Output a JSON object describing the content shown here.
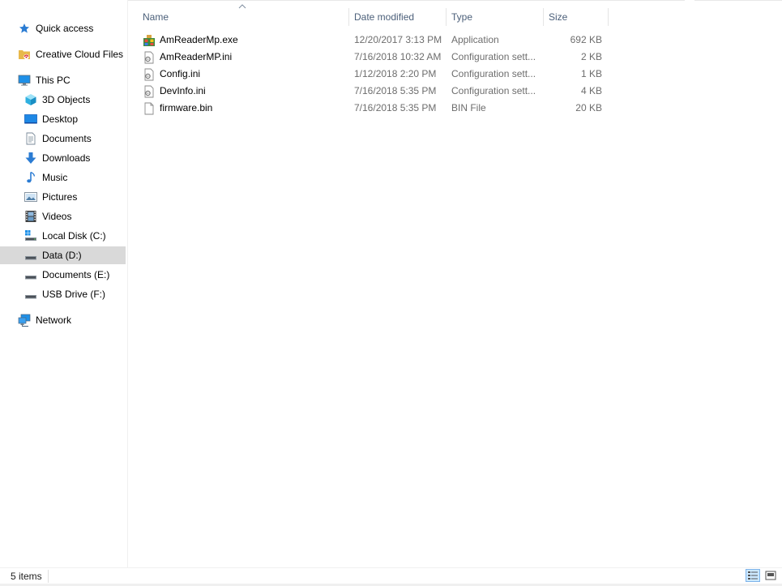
{
  "nav": {
    "items": [
      {
        "label": "Quick access",
        "icon": "star-icon"
      },
      {
        "label": "Creative Cloud Files",
        "icon": "creative-cloud-folder-icon"
      },
      {
        "label": "This PC",
        "icon": "computer-icon"
      },
      {
        "label": "3D Objects",
        "icon": "cube-icon"
      },
      {
        "label": "Desktop",
        "icon": "desktop-icon"
      },
      {
        "label": "Documents",
        "icon": "documents-icon"
      },
      {
        "label": "Downloads",
        "icon": "download-arrow-icon"
      },
      {
        "label": "Music",
        "icon": "music-note-icon"
      },
      {
        "label": "Pictures",
        "icon": "pictures-icon"
      },
      {
        "label": "Videos",
        "icon": "film-icon"
      },
      {
        "label": "Local Disk (C:)",
        "icon": "windows-drive-icon"
      },
      {
        "label": "Data (D:)",
        "icon": "drive-icon",
        "selected": true
      },
      {
        "label": "Documents (E:)",
        "icon": "drive-icon"
      },
      {
        "label": "USB Drive (F:)",
        "icon": "drive-icon"
      },
      {
        "label": "Network",
        "icon": "network-icon"
      }
    ]
  },
  "columns": {
    "name": "Name",
    "date": "Date modified",
    "type": "Type",
    "size": "Size",
    "sort": "ascending"
  },
  "files": [
    {
      "name": "AmReaderMp.exe",
      "date": "12/20/2017 3:13 PM",
      "type": "Application",
      "size": "692 KB",
      "icon": "application-exe-icon"
    },
    {
      "name": "AmReaderMP.ini",
      "date": "7/16/2018 10:32 AM",
      "type": "Configuration sett...",
      "size": "2 KB",
      "icon": "config-file-icon"
    },
    {
      "name": "Config.ini",
      "date": "1/12/2018 2:20 PM",
      "type": "Configuration sett...",
      "size": "1 KB",
      "icon": "config-file-icon"
    },
    {
      "name": "DevInfo.ini",
      "date": "7/16/2018 5:35 PM",
      "type": "Configuration sett...",
      "size": "4 KB",
      "icon": "config-file-icon"
    },
    {
      "name": "firmware.bin",
      "date": "7/16/2018 5:35 PM",
      "type": "BIN File",
      "size": "20 KB",
      "icon": "blank-file-icon"
    }
  ],
  "status": {
    "item_count": "5 items",
    "view_mode": "details"
  },
  "colors": {
    "selection": "#d9d9d9",
    "header_text": "#4c607a",
    "secondary_text": "#6d6d6d",
    "accent": "#0078d7"
  }
}
